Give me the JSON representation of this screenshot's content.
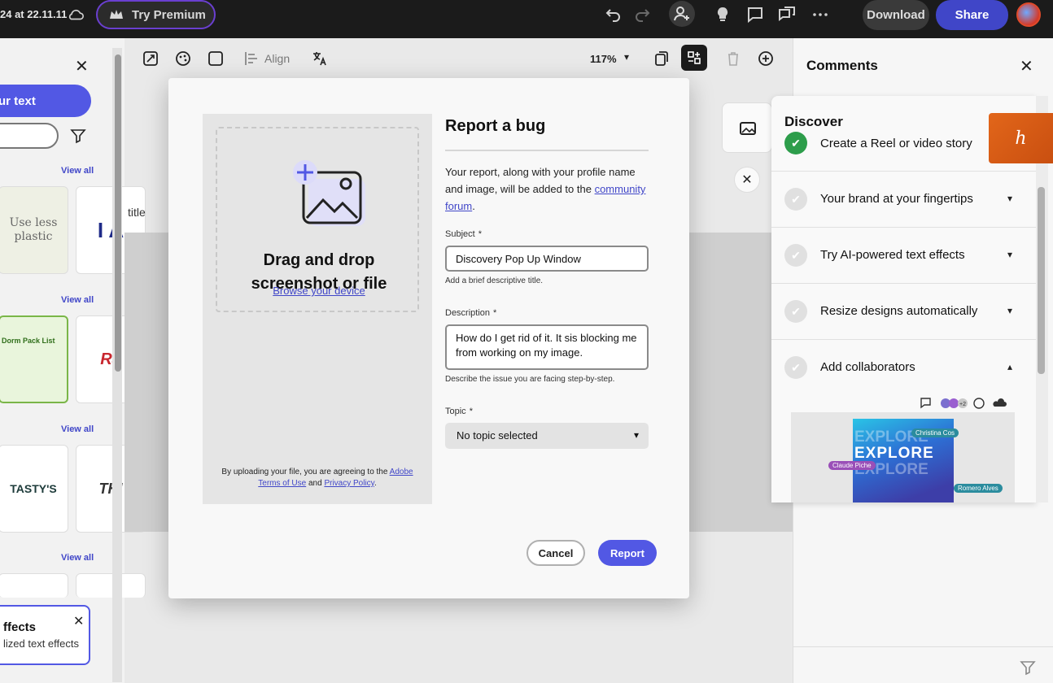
{
  "topbar": {
    "doc_title_fragment": "24 at 22.11.11",
    "premium_label": "Try Premium",
    "download_label": "Download",
    "share_label": "Share"
  },
  "left_panel": {
    "primary_button": "ur text",
    "view_all": "View all",
    "effects_card": {
      "title": "ffects",
      "subtitle": "lized text effects"
    },
    "thumbnails": [
      "Use less plastic",
      "I A",
      "Dorm Pack List",
      "Ra",
      "TASTY'S",
      "THI"
    ]
  },
  "canvas": {
    "toolbar": {
      "align_label": "Align",
      "zoom": "117%"
    },
    "title_fragment": "title"
  },
  "comments_panel": {
    "title": "Comments"
  },
  "discover": {
    "title": "Discover",
    "items": [
      {
        "label": "Create a Reel or video story",
        "done": true
      },
      {
        "label": "Your brand at your fingertips",
        "done": false,
        "expanded": false
      },
      {
        "label": "Try AI-powered text effects",
        "done": false,
        "expanded": false
      },
      {
        "label": "Resize designs automatically",
        "done": false,
        "expanded": false
      },
      {
        "label": "Add collaborators",
        "done": false,
        "expanded": true
      }
    ],
    "preview": {
      "headline": "EXPLORE",
      "tags": [
        "Christina Cos",
        "Claude Piche",
        "Romero Alves"
      ],
      "count_badge": "+2"
    }
  },
  "modal": {
    "drop": {
      "title_line1": "Drag and drop",
      "title_line2": "screenshot or file",
      "browse_label": "Browse your device",
      "legal_prefix": "By uploading your file, you are agreeing to the ",
      "legal_link1": "Adobe Terms of Use",
      "legal_mid": " and ",
      "legal_link2": "Privacy Policy",
      "legal_suffix": "."
    },
    "title": "Report a bug",
    "intro_prefix": "Your report, along with your profile name and image, will be added to the ",
    "intro_link": "community forum",
    "intro_suffix": ".",
    "subject": {
      "label": "Subject",
      "required": "*",
      "value": "Discovery Pop Up Window",
      "help": "Add a brief descriptive title."
    },
    "description": {
      "label": "Description",
      "required": "*",
      "value": "How do I get rid of it.  It sis blocking me from working on my image.",
      "help": "Describe the issue you are facing step-by-step."
    },
    "topic": {
      "label": "Topic",
      "required": "*",
      "value": "No topic selected"
    },
    "cancel_label": "Cancel",
    "report_label": "Report"
  },
  "colors": {
    "accent": "#5258e4",
    "topbar": "#1b1b1b",
    "success": "#2d9d4b"
  }
}
